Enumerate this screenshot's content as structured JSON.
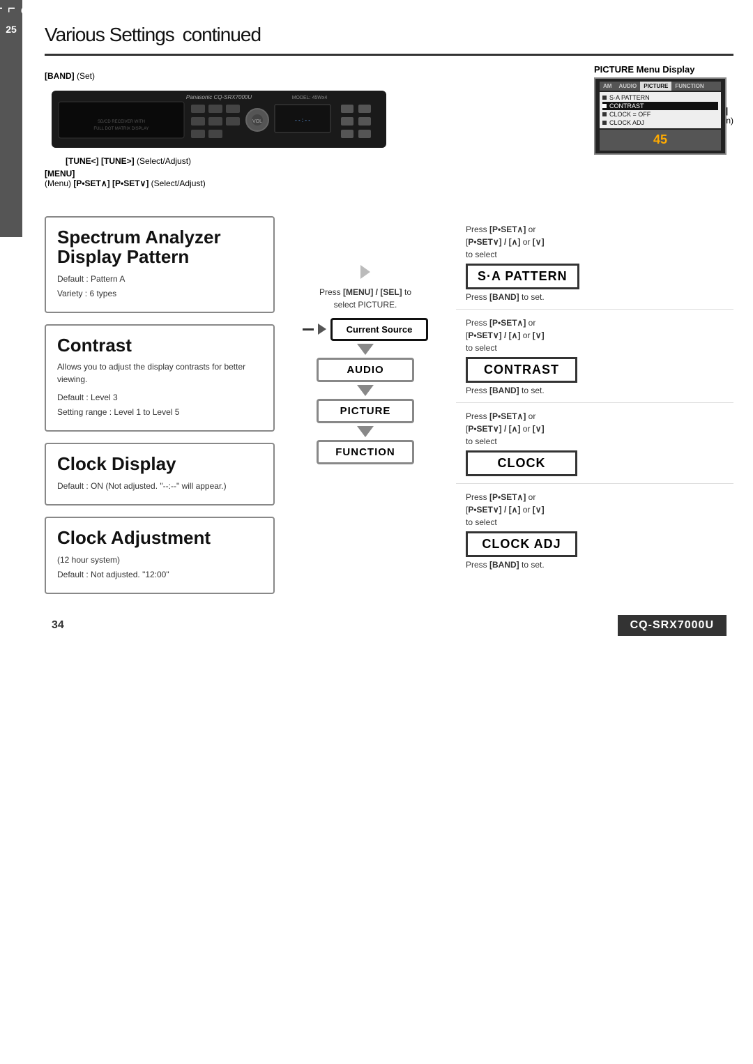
{
  "page": {
    "title": "Various Settings",
    "title_suffix": "continued",
    "page_number": "34",
    "lang_tab": [
      "E",
      "N",
      "G",
      "L",
      "I",
      "S",
      "H",
      "25"
    ]
  },
  "device": {
    "brand": "Panasonic CQ-SRX7000U",
    "model": "MODEL: 45Wx4",
    "slot_text": "SD/CD RECEIVER WITH FULL DOT MATRIX DISPLAY"
  },
  "annotations": {
    "band": "[BAND]",
    "band_note": "(Set)",
    "disp": "[DISP]",
    "disp_note": "(Return)",
    "menu": "[MENU]",
    "menu_note": "(Menu)",
    "tune": "[TUNE<] [TUNE>]",
    "tune_note": "(Select/Adjust)",
    "pset": "[P•SET∧] [P•SET∨]",
    "pset_note": "(Select/Adjust)"
  },
  "picture_menu": {
    "title": "PICTURE Menu Display",
    "tabs": [
      "AM",
      "AUDIO",
      "PICTURE",
      "FUNCTION"
    ],
    "active_tab": "PICTURE",
    "items": [
      {
        "label": "S·A PATTERN",
        "selected": false
      },
      {
        "label": "CONTRAST",
        "selected": false
      },
      {
        "label": "CLOCK = OFF",
        "selected": false
      },
      {
        "label": "CLOCK  ADJ",
        "selected": false
      }
    ]
  },
  "features": [
    {
      "id": "spectrum",
      "title": "Spectrum Analyzer\nDisplay Pattern",
      "body": [
        "Default : Pattern A",
        "Variety : 6 types"
      ]
    },
    {
      "id": "contrast",
      "title": "Contrast",
      "body": [
        "Allows you to adjust the display contrasts for better viewing.",
        "",
        "Default : Level 3",
        "Setting range : Level 1 to Level 5"
      ]
    },
    {
      "id": "clock_display",
      "title": "Clock Display",
      "body": [
        "Default : ON (Not adjusted. \"--:--\" will appear.)"
      ]
    },
    {
      "id": "clock_adj",
      "title": "Clock Adjustment",
      "body": [
        "(12 hour system)",
        "Default : Not adjusted. “12:00”"
      ]
    }
  ],
  "middle": {
    "press_text": "Press [MENU] / [SEL] to select PICTURE.",
    "flow": [
      {
        "label": "Current Source",
        "type": "current-source"
      },
      {
        "label": "AUDIO",
        "type": "audio"
      },
      {
        "label": "PICTURE",
        "type": "picture"
      },
      {
        "label": "FUNCTION",
        "type": "function"
      }
    ]
  },
  "right_sections": [
    {
      "id": "sa_pattern",
      "instruction": "Press [P•SET∧] or\n[P•SET∨] / [∧] or [∨]\nto select",
      "label": "S·A PATTERN",
      "press_band": "Press [BAND] to set."
    },
    {
      "id": "contrast",
      "instruction": "Press [P•SET∧] or\n[P•SET∨] / [∧] or [∨]\nto select",
      "label": "CONTRAST",
      "press_band": "Press [BAND] to set."
    },
    {
      "id": "clock",
      "instruction": "Press [P•SET∧] or\n[P•SET∨] / [∧] or [∨]\nto select",
      "label": "CLOCK",
      "press_band": ""
    },
    {
      "id": "clock_adj",
      "instruction": "Press [P•SET∧] or\n[P•SET∨] / [∧] or [∨]\nto select",
      "label": "CLOCK ADJ",
      "press_band": "Press [BAND] to set."
    }
  ],
  "footer": {
    "page_number": "34",
    "model": "CQ-SRX7000U"
  }
}
